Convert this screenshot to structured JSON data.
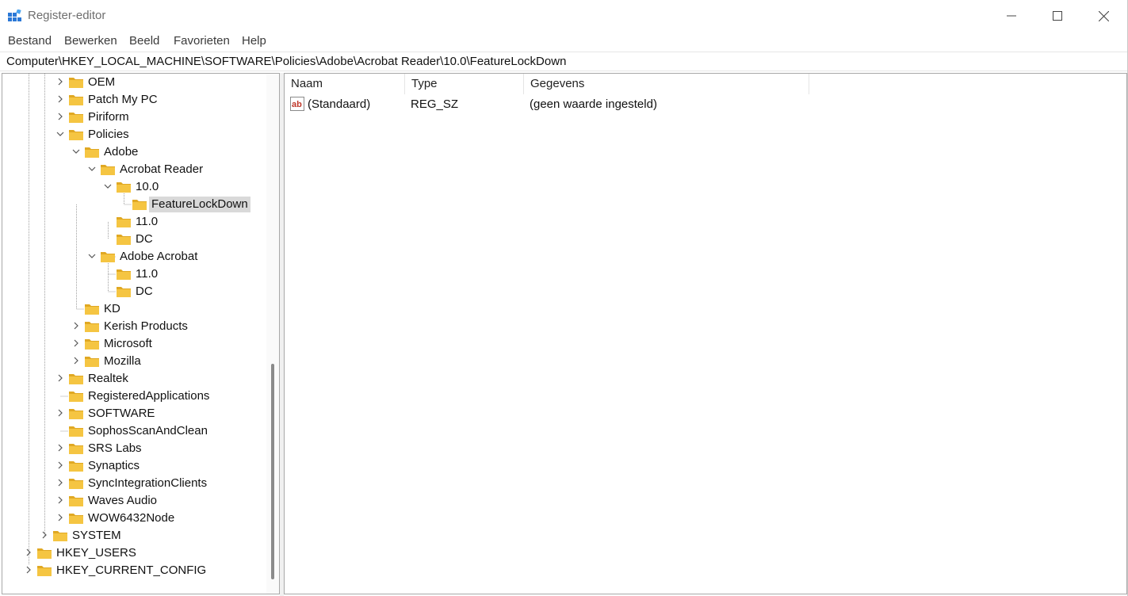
{
  "window": {
    "title": "Register-editor",
    "controls": {
      "minimize": "minimize",
      "maximize": "maximize",
      "close": "close"
    }
  },
  "menu": [
    "Bestand",
    "Bewerken",
    "Beeld",
    "Favorieten",
    "Help"
  ],
  "address": "Computer\\HKEY_LOCAL_MACHINE\\SOFTWARE\\Policies\\Adobe\\Acrobat Reader\\10.0\\FeatureLockDown",
  "tree": [
    {
      "label": "OEM",
      "expander": "collapsed"
    },
    {
      "label": "Patch My PC",
      "expander": "collapsed"
    },
    {
      "label": "Piriform",
      "expander": "collapsed"
    },
    {
      "label": "Policies",
      "expander": "expanded"
    },
    {
      "label": "Adobe",
      "expander": "expanded"
    },
    {
      "label": "Acrobat Reader",
      "expander": "expanded"
    },
    {
      "label": "10.0",
      "expander": "expanded"
    },
    {
      "label": "FeatureLockDown",
      "expander": "none",
      "selected": true
    },
    {
      "label": "11.0",
      "expander": "none"
    },
    {
      "label": "DC",
      "expander": "none"
    },
    {
      "label": "Adobe Acrobat",
      "expander": "expanded"
    },
    {
      "label": "11.0",
      "expander": "none"
    },
    {
      "label": "DC",
      "expander": "none"
    },
    {
      "label": "KD",
      "expander": "none"
    },
    {
      "label": "Kerish Products",
      "expander": "collapsed"
    },
    {
      "label": "Microsoft",
      "expander": "collapsed"
    },
    {
      "label": "Mozilla",
      "expander": "collapsed"
    },
    {
      "label": "Realtek",
      "expander": "collapsed"
    },
    {
      "label": "RegisteredApplications",
      "expander": "none"
    },
    {
      "label": "SOFTWARE",
      "expander": "collapsed"
    },
    {
      "label": "SophosScanAndClean",
      "expander": "none"
    },
    {
      "label": "SRS Labs",
      "expander": "collapsed"
    },
    {
      "label": "Synaptics",
      "expander": "collapsed"
    },
    {
      "label": "SyncIntegrationClients",
      "expander": "collapsed"
    },
    {
      "label": "Waves Audio",
      "expander": "collapsed"
    },
    {
      "label": "WOW6432Node",
      "expander": "collapsed"
    },
    {
      "label": "SYSTEM",
      "expander": "collapsed"
    },
    {
      "label": "HKEY_USERS",
      "expander": "collapsed"
    },
    {
      "label": "HKEY_CURRENT_CONFIG",
      "expander": "collapsed"
    }
  ],
  "list": {
    "columns": [
      "Naam",
      "Type",
      "Gegevens"
    ],
    "rows": [
      {
        "icon": "string-value-icon",
        "name": "(Standaard)",
        "type": "REG_SZ",
        "data": "(geen waarde ingesteld)"
      }
    ]
  },
  "colors": {
    "folder": "#f5c542",
    "folder_dark": "#e0a823",
    "selection": "#d9d9d9",
    "string_icon": "#c0392b"
  }
}
